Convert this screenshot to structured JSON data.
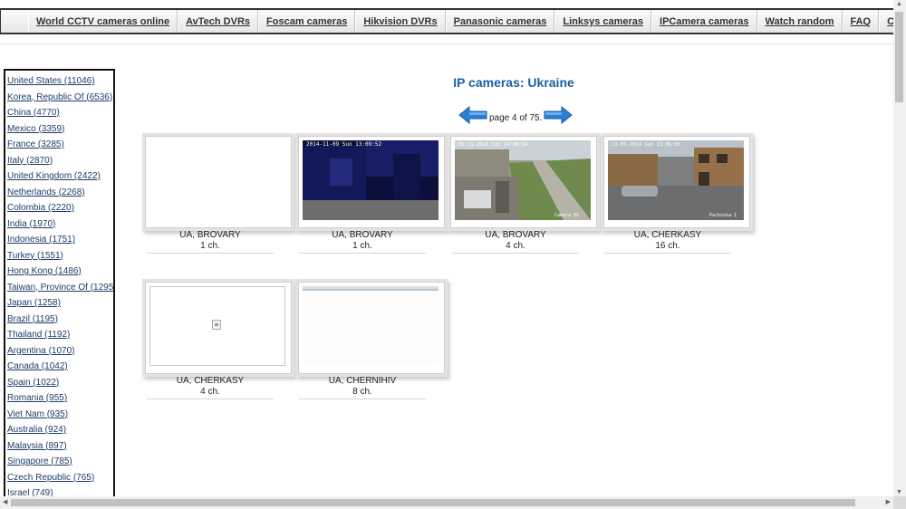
{
  "nav": {
    "items": [
      {
        "label": "World CCTV cameras online"
      },
      {
        "label": "AvTech DVRs"
      },
      {
        "label": "Foscam cameras"
      },
      {
        "label": "Hikvision DVRs"
      },
      {
        "label": "Panasonic cameras"
      },
      {
        "label": "Linksys cameras"
      },
      {
        "label": "IPCamera cameras"
      },
      {
        "label": "Watch random"
      },
      {
        "label": "FAQ"
      },
      {
        "label": "Contacts"
      }
    ]
  },
  "countries": [
    {
      "label": "United States (11046)"
    },
    {
      "label": "Korea, Republic Of (6536)"
    },
    {
      "label": "China (4770)"
    },
    {
      "label": "Mexico (3359)"
    },
    {
      "label": "France (3285)"
    },
    {
      "label": "Italy (2870)"
    },
    {
      "label": "United Kingdom (2422)"
    },
    {
      "label": "Netherlands (2268)"
    },
    {
      "label": "Colombia (2220)"
    },
    {
      "label": "India (1970)"
    },
    {
      "label": "Indonesia (1751)"
    },
    {
      "label": "Turkey (1551)"
    },
    {
      "label": "Hong Kong (1486)"
    },
    {
      "label": "Taiwan, Province Of (1295)"
    },
    {
      "label": "Japan (1258)"
    },
    {
      "label": "Brazil (1195)"
    },
    {
      "label": "Thailand (1192)"
    },
    {
      "label": "Argentina (1070)"
    },
    {
      "label": "Canada (1042)"
    },
    {
      "label": "Spain (1022)"
    },
    {
      "label": "Romania (955)"
    },
    {
      "label": "Viet Nam (935)"
    },
    {
      "label": "Australia (924)"
    },
    {
      "label": "Malaysia (897)"
    },
    {
      "label": "Singapore (785)"
    },
    {
      "label": "Czech Republic (765)"
    },
    {
      "label": "Israel (749)"
    }
  ],
  "main": {
    "title": "IP cameras: Ukraine",
    "pager_text": "page 4 of 75.",
    "cameras": [
      {
        "location": "UA, BROVARY",
        "channels": "1 ch.",
        "thumb": "blank"
      },
      {
        "location": "UA, BROVARY",
        "channels": "1 ch.",
        "thumb": "dark-feed",
        "overlay": "2014-11-09 Sun 13:09:52"
      },
      {
        "location": "UA, BROVARY",
        "channels": "4 ch.",
        "thumb": "yard-feed",
        "overlay": "09-11-2014 Sun 14:08:24",
        "label": "Camera 01"
      },
      {
        "location": "UA, CHERKASY",
        "channels": "16 ch.",
        "thumb": "courtyard-feed",
        "overlay": "11-09-2014 Sun 13:06:05",
        "label": "Parkovka 1"
      },
      {
        "location": "UA, CHERKASY",
        "channels": "4 ch.",
        "thumb": "broken-image"
      },
      {
        "location": "UA, CHERNIHIV",
        "channels": "8 ch.",
        "thumb": "washed-out-feed"
      }
    ]
  },
  "colors": {
    "accent": "#1c5fa8",
    "arrow": "#2a7fd4",
    "link": "#1d3b6b"
  }
}
